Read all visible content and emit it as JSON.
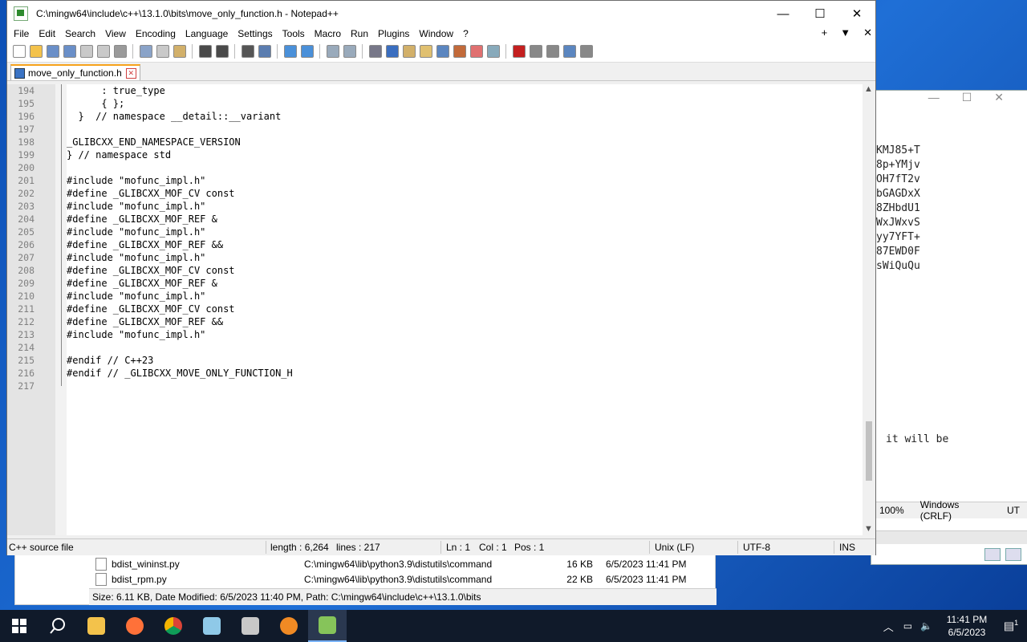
{
  "window": {
    "title": "C:\\mingw64\\include\\c++\\13.1.0\\bits\\move_only_function.h - Notepad++",
    "minimize": "—",
    "maximize": "☐",
    "close": "✕"
  },
  "menu": {
    "items": [
      "File",
      "Edit",
      "Search",
      "View",
      "Encoding",
      "Language",
      "Settings",
      "Tools",
      "Macro",
      "Run",
      "Plugins",
      "Window",
      "?"
    ],
    "right": [
      "+",
      "▼",
      "✕"
    ]
  },
  "tab": {
    "label": "move_only_function.h",
    "close": "✕"
  },
  "editor": {
    "lines": [
      {
        "n": "194",
        "code": "      : true_type",
        "type": "plain"
      },
      {
        "n": "195",
        "code": "      { };",
        "type": "plain"
      },
      {
        "n": "196",
        "pre": "  }  ",
        "code": "// namespace __detail::__variant",
        "type": "comment"
      },
      {
        "n": "197",
        "code": "",
        "type": "plain"
      },
      {
        "n": "198",
        "code": "_GLIBCXX_END_NAMESPACE_VERSION",
        "type": "plain"
      },
      {
        "n": "199",
        "pre": "} ",
        "code": "// namespace std",
        "type": "comment"
      },
      {
        "n": "200",
        "code": "",
        "type": "plain"
      },
      {
        "n": "201",
        "code": "#include \"mofunc_impl.h\"",
        "type": "pp"
      },
      {
        "n": "202",
        "code": "#define _GLIBCXX_MOF_CV const",
        "type": "pp"
      },
      {
        "n": "203",
        "code": "#include \"mofunc_impl.h\"",
        "type": "pp"
      },
      {
        "n": "204",
        "code": "#define _GLIBCXX_MOF_REF &",
        "type": "pp"
      },
      {
        "n": "205",
        "code": "#include \"mofunc_impl.h\"",
        "type": "pp"
      },
      {
        "n": "206",
        "code": "#define _GLIBCXX_MOF_REF &&",
        "type": "pp"
      },
      {
        "n": "207",
        "code": "#include \"mofunc_impl.h\"",
        "type": "pp"
      },
      {
        "n": "208",
        "code": "#define _GLIBCXX_MOF_CV const",
        "type": "pp"
      },
      {
        "n": "209",
        "code": "#define _GLIBCXX_MOF_REF &",
        "type": "pp"
      },
      {
        "n": "210",
        "code": "#include \"mofunc_impl.h\"",
        "type": "pp"
      },
      {
        "n": "211",
        "code": "#define _GLIBCXX_MOF_CV const",
        "type": "pp"
      },
      {
        "n": "212",
        "code": "#define _GLIBCXX_MOF_REF &&",
        "type": "pp"
      },
      {
        "n": "213",
        "code": "#include \"mofunc_impl.h\"",
        "type": "pp"
      },
      {
        "n": "214",
        "code": "",
        "type": "plain"
      },
      {
        "n": "215",
        "code": "#endif // C++23",
        "type": "pp"
      },
      {
        "n": "216",
        "code": "#endif // _GLIBCXX_MOVE_ONLY_FUNCTION_H",
        "type": "pp"
      },
      {
        "n": "217",
        "code": "",
        "type": "plain"
      }
    ]
  },
  "status": {
    "filetype": "C++ source file",
    "length": "length : 6,264",
    "lines": "lines : 217",
    "ln": "Ln : 1",
    "col": "Col : 1",
    "pos": "Pos : 1",
    "eol": "Unix (LF)",
    "encoding": "UTF-8",
    "mode": "INS"
  },
  "bg_window": {
    "lines": [
      "KMJ85+T",
      "8p+YMjv",
      "OH7fT2v",
      "bGAGDxX",
      "8ZHbdU1",
      "WxJWxvS",
      "yy7YFT+",
      "87EWD0F",
      "sWiQuQu"
    ],
    "text": "it will be",
    "zoom": "100%",
    "eol": "Windows (CRLF)",
    "enc": "UT"
  },
  "explorer": {
    "rows": [
      {
        "name": "bdist_wininst.py",
        "path": "C:\\mingw64\\lib\\python3.9\\distutils\\command",
        "size": "16 KB",
        "date": "6/5/2023 11:41 PM"
      },
      {
        "name": "bdist_rpm.py",
        "path": "C:\\mingw64\\lib\\python3.9\\distutils\\command",
        "size": "22 KB",
        "date": "6/5/2023 11:41 PM"
      }
    ],
    "status": "Size: 6.11 KB, Date Modified: 6/5/2023 11:40 PM, Path: C:\\mingw64\\include\\c++\\13.1.0\\bits"
  },
  "taskbar": {
    "time": "11:41 PM",
    "date": "6/5/2023",
    "icons": [
      "start-icon",
      "search-icon",
      "file-explorer-icon",
      "firefox-icon",
      "chrome-icon",
      "notepad-icon",
      "tools-icon",
      "search-tool-icon",
      "notepadpp-icon"
    ],
    "notifications": "1"
  },
  "colors": {
    "comment": "#008000",
    "preprocessor": "#804000",
    "tab_accent": "#f6a21c",
    "taskbar": "#101a2a"
  }
}
